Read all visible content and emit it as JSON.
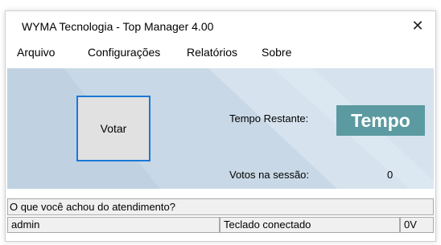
{
  "window": {
    "title": "WYMA Tecnologia - Top Manager 4.00",
    "close_glyph": "✕"
  },
  "menu": {
    "items": [
      "Arquivo",
      "Configurações",
      "Relatórios",
      "Sobre"
    ]
  },
  "main": {
    "vote_button_label": "Votar",
    "tempo_label": "Tempo Restante:",
    "tempo_value": "Tempo",
    "votos_label": "Votos na sessão:",
    "votos_value": "0"
  },
  "question": {
    "text": "O que você achou do atendimento?"
  },
  "status": {
    "user": "admin",
    "keyboard": "Teclado conectado",
    "voltage": "0V"
  },
  "colors": {
    "panel_background": "#c8d8e6",
    "tempo_background": "#5b9aa0",
    "button_border": "#1b78d6"
  }
}
